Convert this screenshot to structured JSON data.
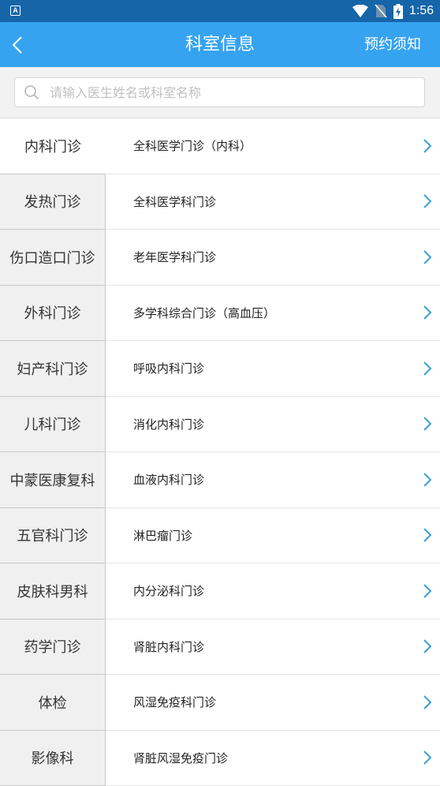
{
  "status_bar": {
    "time": "1:56",
    "app_indicator": "A",
    "icons": [
      "wifi-icon",
      "no-sim-icon",
      "battery-charging-icon"
    ]
  },
  "header": {
    "title": "科室信息",
    "action_label": "预约须知",
    "back_icon": "chevron-left-icon"
  },
  "search": {
    "placeholder": "请输入医生姓名或科室名称",
    "value": "",
    "icon": "search-icon"
  },
  "colors": {
    "app_bar": "#35a3f0",
    "status_bar": "#1565a8",
    "chevron": "#3aa0d8",
    "sidebar_bg": "#f0f0f0"
  },
  "categories": [
    {
      "label": "内科门诊",
      "selected": true
    },
    {
      "label": "发热门诊"
    },
    {
      "label": "伤口造口门诊"
    },
    {
      "label": "外科门诊"
    },
    {
      "label": "妇产科门诊"
    },
    {
      "label": "儿科门诊"
    },
    {
      "label": "中蒙医康复科"
    },
    {
      "label": "五官科门诊"
    },
    {
      "label": "皮肤科男科"
    },
    {
      "label": "药学门诊"
    },
    {
      "label": "体检"
    },
    {
      "label": "影像科"
    }
  ],
  "departments": [
    {
      "label": "全科医学门诊（内科）"
    },
    {
      "label": "全科医学科门诊"
    },
    {
      "label": "老年医学科门诊"
    },
    {
      "label": "多学科综合门诊（高血压）"
    },
    {
      "label": "呼吸内科门诊"
    },
    {
      "label": "消化内科门诊"
    },
    {
      "label": "血液内科门诊"
    },
    {
      "label": "淋巴瘤门诊"
    },
    {
      "label": "内分泌科门诊"
    },
    {
      "label": "肾脏内科门诊"
    },
    {
      "label": "风湿免疫科门诊"
    },
    {
      "label": "肾脏风湿免疫门诊"
    }
  ]
}
